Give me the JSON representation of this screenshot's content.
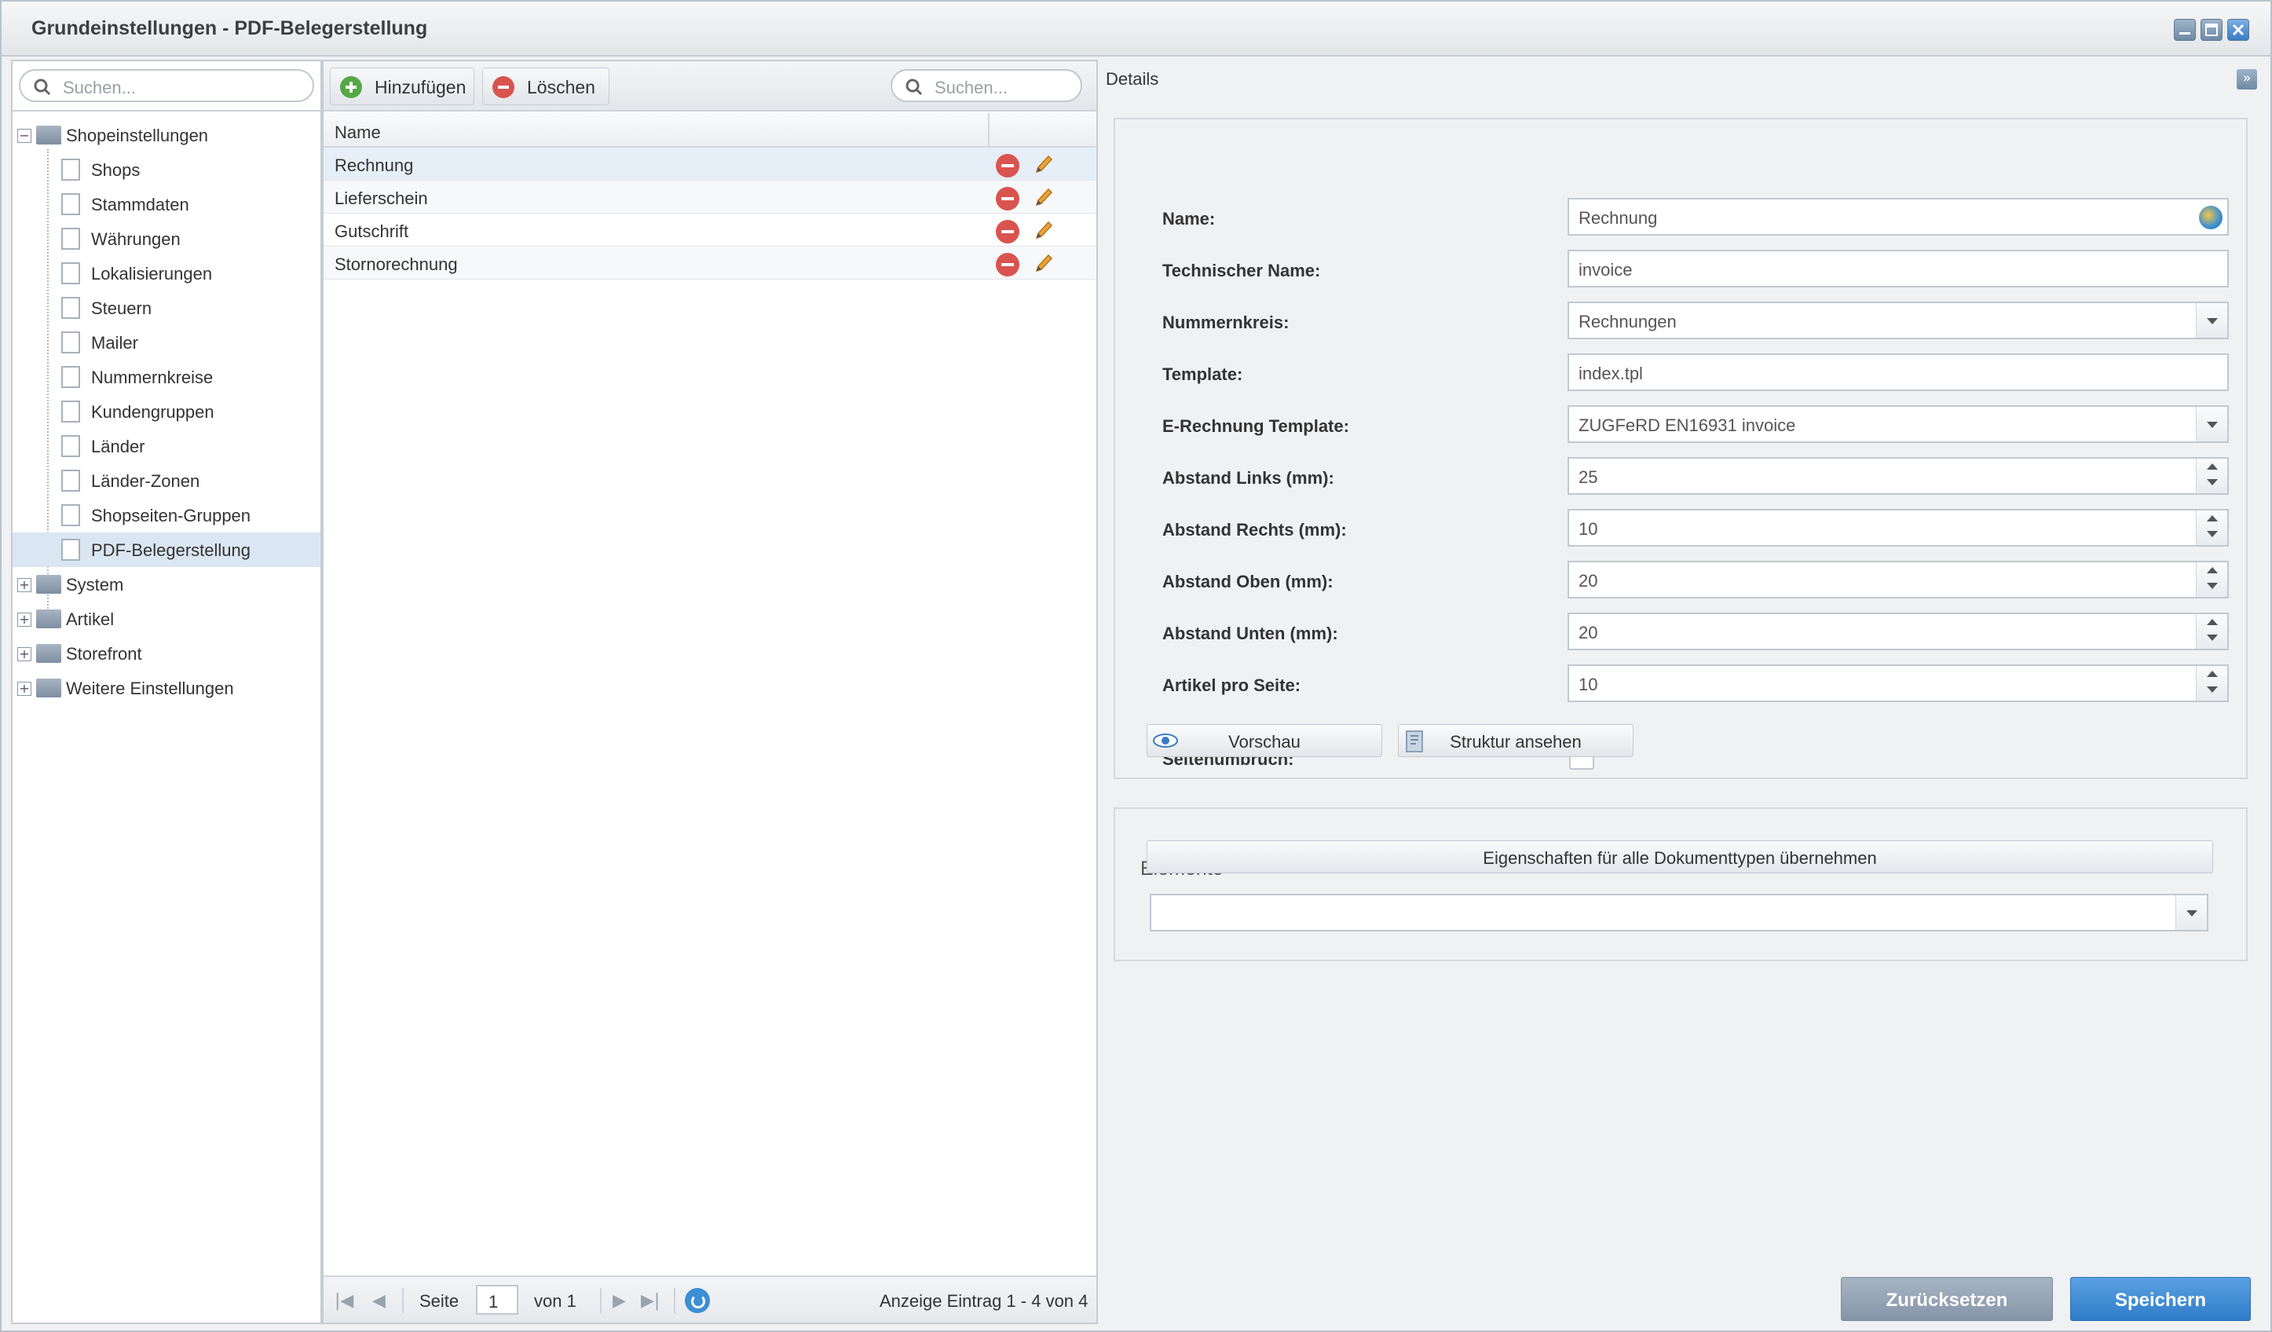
{
  "window": {
    "title": "Grundeinstellungen - PDF-Belegerstellung"
  },
  "tree": {
    "search_placeholder": "Suchen...",
    "items": [
      {
        "label": "Shopeinstellungen",
        "type": "folder-open"
      },
      {
        "label": "Shops",
        "type": "leaf"
      },
      {
        "label": "Stammdaten",
        "type": "leaf"
      },
      {
        "label": "Währungen",
        "type": "leaf"
      },
      {
        "label": "Lokalisierungen",
        "type": "leaf"
      },
      {
        "label": "Steuern",
        "type": "leaf"
      },
      {
        "label": "Mailer",
        "type": "leaf"
      },
      {
        "label": "Nummernkreise",
        "type": "leaf"
      },
      {
        "label": "Kundengruppen",
        "type": "leaf"
      },
      {
        "label": "Länder",
        "type": "leaf"
      },
      {
        "label": "Länder-Zonen",
        "type": "leaf"
      },
      {
        "label": "Shopseiten-Gruppen",
        "type": "leaf"
      },
      {
        "label": "PDF-Belegerstellung",
        "type": "leaf",
        "selected": true
      },
      {
        "label": "System",
        "type": "folder"
      },
      {
        "label": "Artikel",
        "type": "folder"
      },
      {
        "label": "Storefront",
        "type": "folder"
      },
      {
        "label": "Weitere Einstellungen",
        "type": "folder"
      }
    ]
  },
  "list": {
    "add_label": "Hinzufügen",
    "delete_label": "Löschen",
    "search_placeholder": "Suchen...",
    "column_name": "Name",
    "rows": [
      "Rechnung",
      "Lieferschein",
      "Gutschrift",
      "Stornorechnung"
    ],
    "pager": {
      "page_label": "Seite",
      "page_value": "1",
      "of_label": "von 1",
      "display_info": "Anzeige Eintrag 1 - 4 von 4"
    }
  },
  "details": {
    "title": "Details",
    "fields": {
      "name": {
        "label": "Name:",
        "value": "Rechnung"
      },
      "technical_name": {
        "label": "Technischer Name:",
        "value": "invoice"
      },
      "number_range": {
        "label": "Nummernkreis:",
        "value": "Rechnungen"
      },
      "template": {
        "label": "Template:",
        "value": "index.tpl"
      },
      "e_invoice_template": {
        "label": "E-Rechnung Template:",
        "value": "ZUGFeRD EN16931 invoice"
      },
      "margin_left": {
        "label": "Abstand Links (mm):",
        "value": "25"
      },
      "margin_right": {
        "label": "Abstand Rechts (mm):",
        "value": "10"
      },
      "margin_top": {
        "label": "Abstand Oben (mm):",
        "value": "20"
      },
      "margin_bottom": {
        "label": "Abstand Unten (mm):",
        "value": "20"
      },
      "items_per_page": {
        "label": "Artikel pro Seite:",
        "value": "10"
      },
      "page_break": {
        "label": "Seitenumbruch:",
        "checked": false
      }
    },
    "preview_label": "Vorschau",
    "structure_label": "Struktur ansehen",
    "elements": {
      "legend": "Elemente",
      "apply_all_label": "Eigenschaften für alle Dokumenttypen übernehmen",
      "select_value": ""
    },
    "reset_label": "Zurücksetzen",
    "save_label": "Speichern"
  },
  "colors": {
    "accent": "#2f7cc8",
    "selected_row": "#dbe6f3",
    "add_green": "#54a845",
    "delete_red": "#d9534f"
  }
}
